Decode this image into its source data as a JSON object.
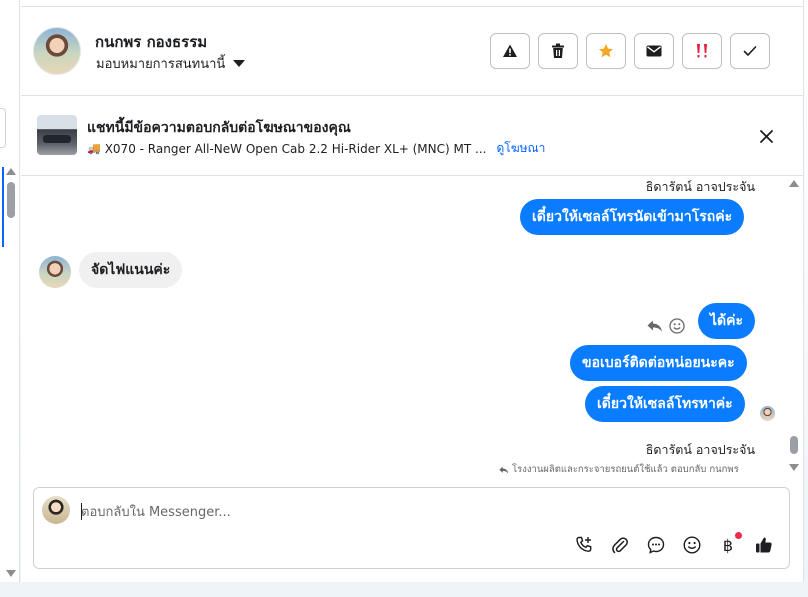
{
  "header": {
    "contact_name": "กนกพร กองธรรม",
    "assign_label": "มอบหมายการสนทนานี้"
  },
  "ad": {
    "title": "แชทนี้มีข้อความตอบกลับต่อโฆษณาของคุณ",
    "subtitle": "X070 - Ranger All-NeW Open Cab 2.2 Hi-Rider XL+ (MNC) MT ...",
    "link_label": "ดูโฆษณา"
  },
  "messages": {
    "sender_top": "ธิดารัตน์ อาจประจัน",
    "out1": "เดี๋ยวให้เซลล์โทรนัดเข้ามาโรถค่ะ",
    "in1": "จัดไฟแนนค่ะ",
    "out2": "ได้ค่ะ",
    "out3": "ขอเบอร์ติดต่อหน่อยนะคะ",
    "out4": "เดี๋ยวให้เซลล์โทรหาค่ะ",
    "sender_bottom": "ธิดารัตน์ อาจประจัน",
    "reply_note": "โรงงานผลิตและกระจายรถยนต์ใช้แล้ว ตอบกลับ กนกพร"
  },
  "composer": {
    "placeholder": "ตอบกลับใน Messenger...",
    "currency_symbol": "฿"
  },
  "colors": {
    "accent": "#0866ff",
    "outgoing_bubble": "#0a7cff",
    "star": "#f5a623",
    "flag_red": "#e41e3f"
  }
}
